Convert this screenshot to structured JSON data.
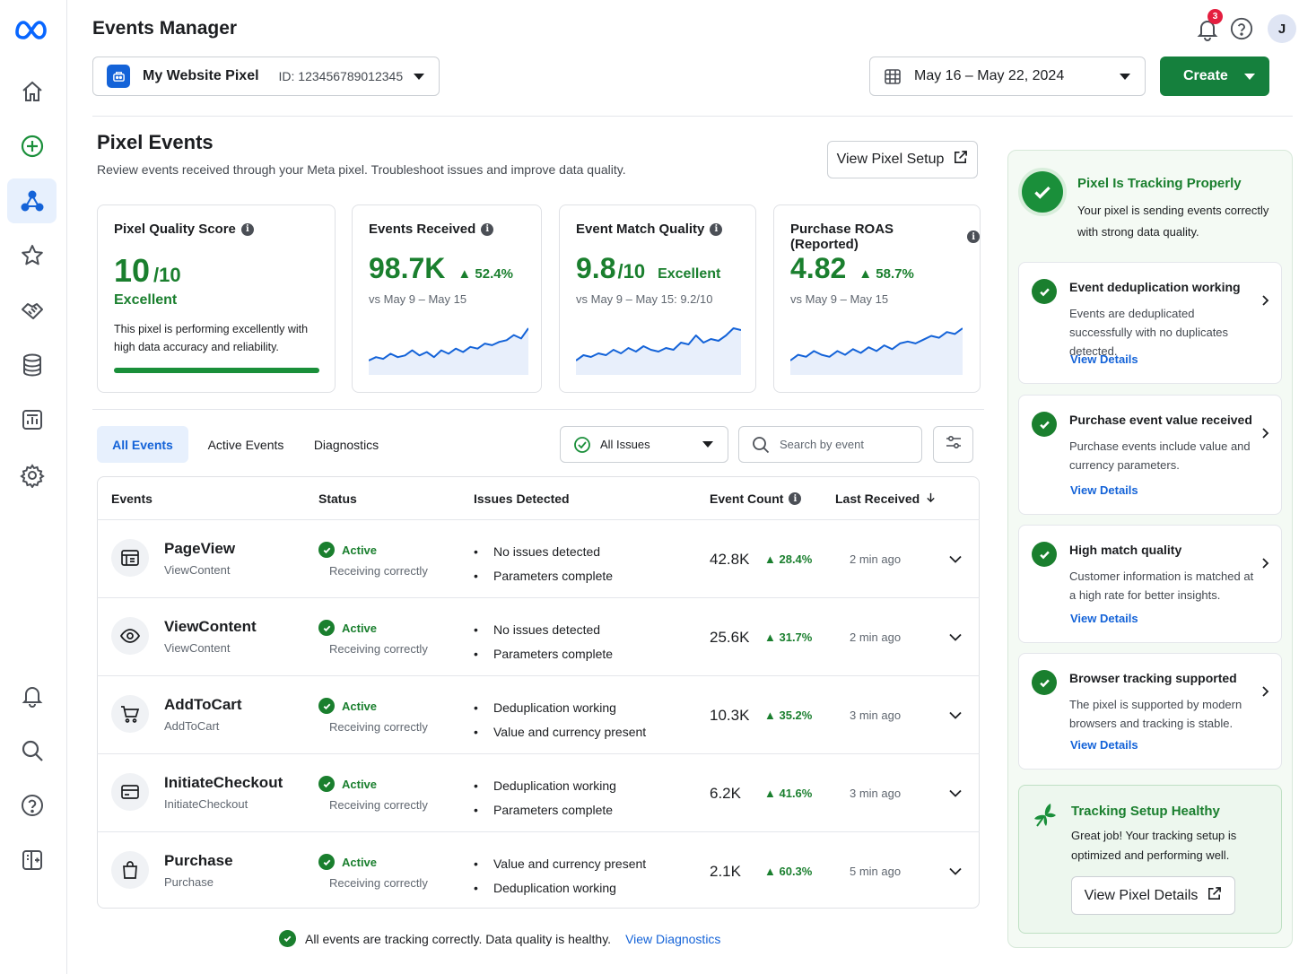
{
  "app": {
    "title": "Events Manager",
    "notification_count": "3",
    "avatar_initial": "J"
  },
  "pixel_selector": {
    "name": "My Website Pixel",
    "id_label": "ID: 123456789012345"
  },
  "date_range": {
    "label": "May 16 – May 22, 2024"
  },
  "create_button": {
    "label": "Create"
  },
  "page": {
    "heading": "Pixel Events",
    "description": "Review events received through your Meta pixel. Troubleshoot issues and improve data quality.",
    "view_setup_label": "View Pixel Setup"
  },
  "metrics": {
    "quality": {
      "title": "Pixel Quality Score",
      "value": "10",
      "suffix": "/10",
      "rating": "Excellent",
      "description": "This pixel is performing excellently with high data accuracy and reliability.",
      "progress_fraction": 1.0
    },
    "events_received": {
      "title": "Events Received",
      "value": "98.7K",
      "change": "52.4%",
      "compare": "vs May 9 – May 15",
      "spark": [
        3,
        5,
        4,
        7,
        5,
        6,
        9,
        6,
        8,
        5,
        9,
        7,
        10,
        8,
        11,
        10,
        13,
        12,
        14,
        15,
        18,
        16,
        22
      ]
    },
    "match_quality": {
      "title": "Event Match Quality",
      "value": "9.8",
      "suffix": "/10",
      "rating": "Excellent",
      "compare": "vs May 9 – May 15: 9.2/10",
      "spark": [
        3,
        6,
        5,
        7,
        6,
        9,
        7,
        10,
        8,
        11,
        9,
        8,
        10,
        9,
        13,
        12,
        17,
        13,
        15,
        14,
        17,
        21,
        20
      ]
    },
    "roas": {
      "title": "Purchase ROAS (Reported)",
      "value": "4.82",
      "change": "58.7%",
      "compare": "vs May 9 – May 15",
      "spark": [
        4,
        7,
        6,
        9,
        7,
        6,
        9,
        7,
        10,
        8,
        11,
        9,
        12,
        10,
        13,
        14,
        13,
        15,
        17,
        16,
        19,
        18,
        21
      ]
    }
  },
  "tabs": [
    "All Events",
    "Active Events",
    "Diagnostics"
  ],
  "filter": {
    "issues_label": "All Issues",
    "search_placeholder": "Search by event"
  },
  "table": {
    "headers": {
      "events": "Events",
      "status": "Status",
      "issues": "Issues Detected",
      "count": "Event Count",
      "last": "Last Received"
    },
    "rows": [
      {
        "name": "PageView",
        "sub": "ViewContent",
        "icon": "browser-window-icon",
        "status": "Active",
        "status_sub": "Receiving correctly",
        "issues": [
          "No issues detected",
          "Parameters complete"
        ],
        "count": "42.8K",
        "change": "28.4%",
        "last": "2 min ago"
      },
      {
        "name": "ViewContent",
        "sub": "ViewContent",
        "icon": "eye-icon",
        "status": "Active",
        "status_sub": "Receiving correctly",
        "issues": [
          "No issues detected",
          "Parameters complete"
        ],
        "count": "25.6K",
        "change": "31.7%",
        "last": "2 min ago"
      },
      {
        "name": "AddToCart",
        "sub": "AddToCart",
        "icon": "cart-icon",
        "status": "Active",
        "status_sub": "Receiving correctly",
        "issues": [
          "Deduplication working",
          "Value and currency present"
        ],
        "count": "10.3K",
        "change": "35.2%",
        "last": "3 min ago"
      },
      {
        "name": "InitiateCheckout",
        "sub": "InitiateCheckout",
        "icon": "credit-card-icon",
        "status": "Active",
        "status_sub": "Receiving correctly",
        "issues": [
          "Deduplication working",
          "Parameters complete"
        ],
        "count": "6.2K",
        "change": "41.6%",
        "last": "3 min ago"
      },
      {
        "name": "Purchase",
        "sub": "Purchase",
        "icon": "shopping-bag-icon",
        "status": "Active",
        "status_sub": "Receiving correctly",
        "issues": [
          "Value and currency present",
          "Deduplication working"
        ],
        "count": "2.1K",
        "change": "60.3%",
        "last": "5 min ago"
      }
    ]
  },
  "footer": {
    "message": "All events are tracking correctly. Data quality is healthy.",
    "link": "View Diagnostics"
  },
  "right_panel": {
    "status_title": "Pixel Is Tracking Properly",
    "status_desc": "Your pixel is sending events correctly with strong data quality.",
    "checks": [
      {
        "title": "Event deduplication working",
        "desc": "Events are deduplicated successfully with no duplicates detected.",
        "link": "View Details"
      },
      {
        "title": "Purchase event value received",
        "desc": "Purchase events include value and currency parameters.",
        "link": "View Details"
      },
      {
        "title": "High match quality",
        "desc": "Customer information is matched at a high rate for better insights.",
        "link": "View Details"
      },
      {
        "title": "Browser tracking supported",
        "desc": "The pixel is supported by modern browsers and tracking is stable.",
        "link": "View Details"
      }
    ],
    "healthy": {
      "title": "Tracking Setup Healthy",
      "desc": "Great job! Your tracking setup is optimized and performing well.",
      "button": "View Pixel Details"
    }
  },
  "colors": {
    "brand_blue": "#1463d8",
    "success_green": "#1a7f2e",
    "create_green": "#15803d"
  }
}
